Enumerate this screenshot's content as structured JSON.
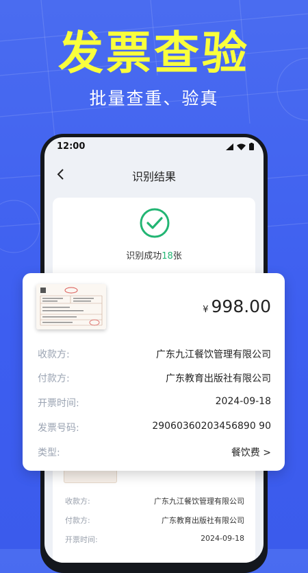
{
  "hero": {
    "title": "发票查验",
    "subtitle": "批量查重、验真"
  },
  "status_bar": {
    "time": "12:00"
  },
  "nav": {
    "title": "识别结果"
  },
  "success": {
    "prefix": "识别成功",
    "count": "18",
    "suffix": "张"
  },
  "invoice_card": {
    "currency": "¥",
    "amount": "998.00",
    "fields": [
      {
        "label": "收款方:",
        "value": "广东九江餐饮管理有限公司"
      },
      {
        "label": "付款方:",
        "value": "广东教育出版社有限公司"
      },
      {
        "label": "开票时间:",
        "value": "2024-09-18"
      },
      {
        "label": "发票号码:",
        "value": "29060360203456890 90"
      },
      {
        "label": "类型:",
        "value": "餐饮费 >"
      }
    ]
  },
  "second_card": {
    "fields": [
      {
        "label": "收款方:",
        "value": "广东九江餐饮管理有限公司"
      },
      {
        "label": "付款方:",
        "value": "广东教育出版社有限公司"
      },
      {
        "label": "开票时间:",
        "value": "2024-09-18"
      }
    ]
  },
  "colors": {
    "background": "#3d5ef0",
    "headline": "#f9ff3c",
    "success": "#22b573"
  },
  "icons": [
    "back-arrow-icon",
    "check-circle-icon",
    "signal-icon",
    "wifi-icon",
    "battery-icon"
  ]
}
